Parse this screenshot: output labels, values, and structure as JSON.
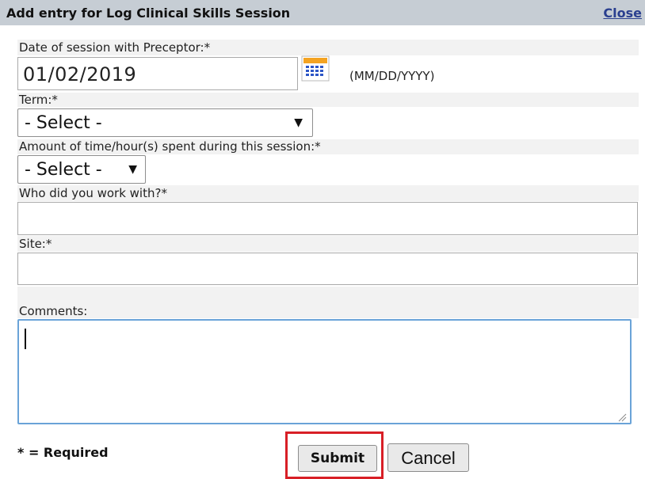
{
  "dialog": {
    "title": "Add entry for Log Clinical Skills Session",
    "close_label": "Close"
  },
  "form": {
    "date_label": "Date of session with Preceptor:*",
    "date_value": "01/02/2019",
    "date_format": "(MM/DD/YYYY)",
    "term_label": "Term:*",
    "term_selected": "- Select -",
    "amount_label": "Amount of time/hour(s) spent during this session:*",
    "amount_selected": "- Select -",
    "who_label": "Who did you work with?*",
    "who_value": "",
    "site_label": "Site:*",
    "site_value": "",
    "comments_label": "Comments:",
    "comments_value": ""
  },
  "footer": {
    "required_note": "* = Required",
    "submit_label": "Submit",
    "cancel_label": "Cancel"
  },
  "colors": {
    "header_bg": "#c6cdd4",
    "close_link": "#2a3f8f",
    "highlight": "#d81f26",
    "focus_border": "#6aa3d8"
  }
}
